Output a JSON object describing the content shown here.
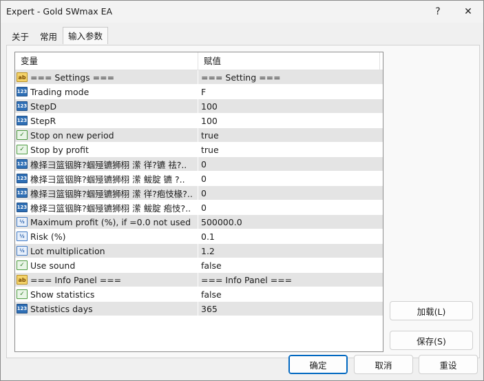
{
  "window": {
    "title": "Expert - Gold SWmax EA",
    "help_label": "?",
    "close_label": "✕"
  },
  "tabs": [
    {
      "label": "关于"
    },
    {
      "label": "常用"
    },
    {
      "label": "输入参数"
    }
  ],
  "grid": {
    "col_variable": "变量",
    "col_value": "赋值",
    "rows": [
      {
        "icon": "ab",
        "type": "string",
        "name": "=== Settings ===",
        "value": "=== Setting ==="
      },
      {
        "icon": "123",
        "type": "int",
        "name": "Trading mode",
        "value": "F"
      },
      {
        "icon": "123",
        "type": "int",
        "name": "StepD",
        "value": "100"
      },
      {
        "icon": "123",
        "type": "int",
        "name": "StepR",
        "value": "100"
      },
      {
        "icon": "bool",
        "type": "bool",
        "name": "Stop on new period",
        "value": "true"
      },
      {
        "icon": "bool",
        "type": "bool",
        "name": "Stop by profit",
        "value": "true"
      },
      {
        "icon": "123",
        "type": "int",
        "name": "橡择彐篮铟脌?蝈殛镳狮栩 潆    徉?镳    祛?..",
        "value": "0"
      },
      {
        "icon": "123",
        "type": "int",
        "name": "橡择彐篮铟脌?蝈殛镳狮栩 潆    鲅腚 镳  ?..",
        "value": "0"
      },
      {
        "icon": "123",
        "type": "int",
        "name": "橡择彐篮铟脌?蝈殛镳狮栩 潆    徉?疱忮椽?..",
        "value": "0"
      },
      {
        "icon": "123",
        "type": "int",
        "name": "橡择彐篮铟脌?蝈殛镳狮栩 潆    鲅腚 疱忮?..",
        "value": "0"
      },
      {
        "icon": "dbl",
        "type": "double",
        "name": "Maximum profit (%), if =0.0 not used",
        "value": "500000.0"
      },
      {
        "icon": "dbl",
        "type": "double",
        "name": "Risk (%)",
        "value": "0.1"
      },
      {
        "icon": "dbl",
        "type": "double",
        "name": "Lot multiplication",
        "value": "1.2"
      },
      {
        "icon": "bool",
        "type": "bool",
        "name": "Use sound",
        "value": "false"
      },
      {
        "icon": "ab",
        "type": "string",
        "name": "=== Info Panel ===",
        "value": "=== Info Panel ==="
      },
      {
        "icon": "bool",
        "type": "bool",
        "name": "Show statistics",
        "value": "false"
      },
      {
        "icon": "123",
        "type": "int",
        "name": "Statistics days",
        "value": "365"
      }
    ]
  },
  "buttons": {
    "load": "加载(L)",
    "save": "保存(S)",
    "ok": "确定",
    "cancel": "取消",
    "reset": "重设"
  },
  "colors": {
    "accent": "#0067c0",
    "row_alt": "#e4e4e4"
  }
}
